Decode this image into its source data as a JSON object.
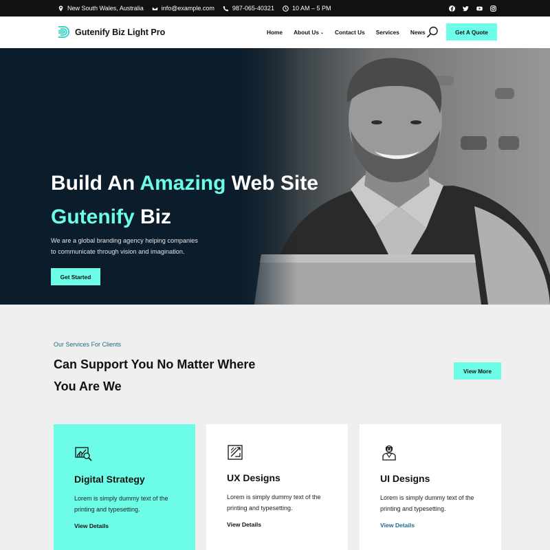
{
  "topbar": {
    "location": "New South Wales, Australia",
    "email": "info@example.com",
    "phone": "987-065-40321",
    "hours": "10 AM – 5 PM",
    "socials": [
      "facebook-icon",
      "twitter-icon",
      "youtube-icon",
      "instagram-icon"
    ]
  },
  "header": {
    "brand": "Gutenify Biz Light Pro",
    "nav": [
      "Home",
      "About Us",
      "Contact Us",
      "Services",
      "News"
    ],
    "quote_label": "Get A Quote"
  },
  "hero": {
    "title_line1_pre": "Build An ",
    "title_line1_hl": "Amazing",
    "title_line1_post": " Web Site",
    "title_line2_hl": "Gutenify",
    "title_line2_post": " Biz",
    "desc_line1": "We are a global branding agency helping companies",
    "desc_line2": "to communicate through vision and imagination.",
    "cta_label": "Get Started",
    "slides_total": 2,
    "slide_active": 1
  },
  "services": {
    "tagline": "Our Services For Clients",
    "heading": "Can Support You No Matter Where You Are We",
    "view_more_label": "View More",
    "cards": [
      {
        "title": "Digital Strategy",
        "text": "Lorem is simply dummy text of the printing and typesetting.",
        "link": "View Details",
        "icon": "strategy-icon"
      },
      {
        "title": "UX Designs",
        "text": "Lorem is simply dummy text of the printing and typesetting.",
        "link": "View Details",
        "icon": "design-icon"
      },
      {
        "title": "UI Designs",
        "text": "Lorem is simply dummy text of the printing and typesetting.",
        "link": "View Details",
        "icon": "designer-icon"
      }
    ]
  },
  "colors": {
    "accent": "#6cfce8",
    "dark": "#0b1c2a",
    "topbar": "#111111",
    "link_teal": "#1f6b8a",
    "background": "#efefef"
  }
}
